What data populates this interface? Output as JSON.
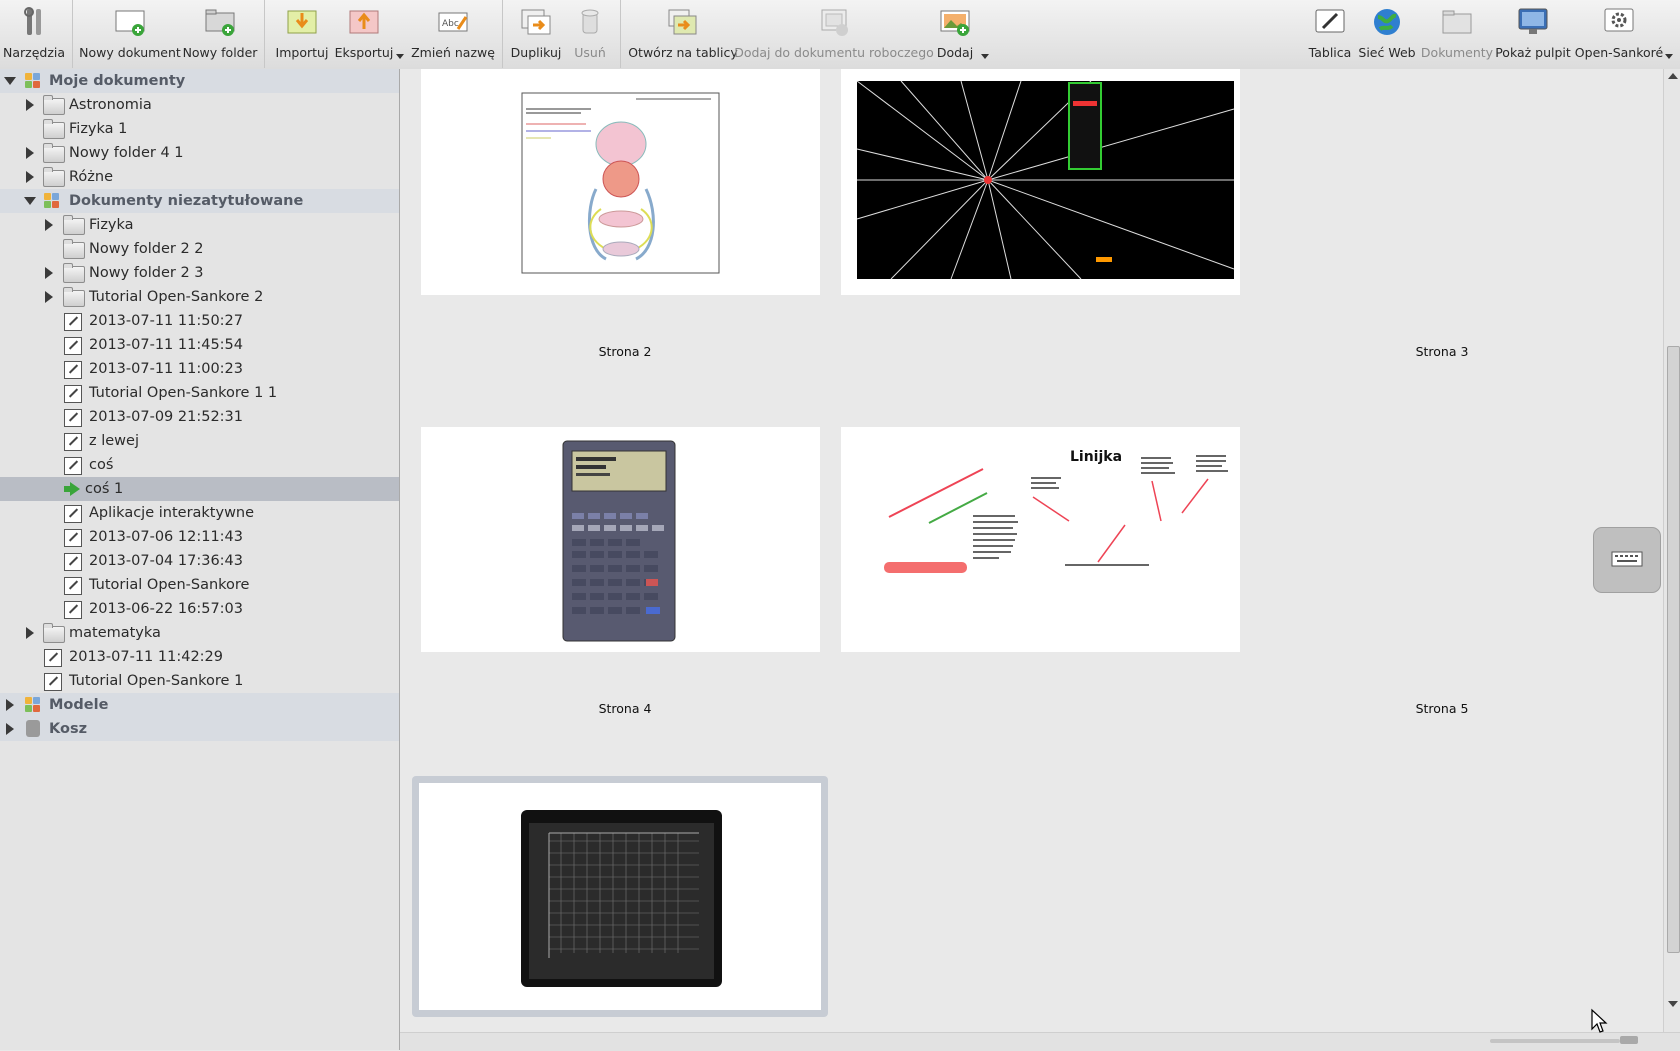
{
  "toolbar": {
    "tools": "Narzędzia",
    "new_document": "Nowy dokument",
    "new_folder": "Nowy folder",
    "import": "Importuj",
    "export": "Eksportuj",
    "rename": "Zmień nazwę",
    "duplicate": "Duplikuj",
    "delete": "Usuń",
    "open_on_board": "Otwórz na tablicy",
    "add_to_working": "Dodaj do dokumentu roboczego",
    "add": "Dodaj",
    "board": "Tablica",
    "web": "Sieć Web",
    "documents": "Dokumenty",
    "show_desktop": "Pokaż pulpit",
    "open_sankore": "Open-Sankoré"
  },
  "sidebar": {
    "items": [
      {
        "label": "Moje dokumenty"
      },
      {
        "label": "Astronomia"
      },
      {
        "label": "Fizyka 1"
      },
      {
        "label": "Nowy folder 4 1"
      },
      {
        "label": "Różne"
      },
      {
        "label": "Dokumenty niezatytułowane"
      },
      {
        "label": "Fizyka"
      },
      {
        "label": "Nowy folder 2 2"
      },
      {
        "label": "Nowy folder 2 3"
      },
      {
        "label": "Tutorial Open-Sankore 2"
      },
      {
        "label": "2013-07-11 11:50:27"
      },
      {
        "label": "2013-07-11 11:45:54"
      },
      {
        "label": "2013-07-11 11:00:23"
      },
      {
        "label": "Tutorial Open-Sankore 1 1"
      },
      {
        "label": "2013-07-09 21:52:31"
      },
      {
        "label": "z lewej"
      },
      {
        "label": "coś"
      },
      {
        "label": "coś 1"
      },
      {
        "label": "Aplikacje interaktywne"
      },
      {
        "label": "2013-07-06 12:11:43"
      },
      {
        "label": "2013-07-04 17:36:43"
      },
      {
        "label": "Tutorial Open-Sankore"
      },
      {
        "label": "2013-06-22 16:57:03"
      },
      {
        "label": "matematyka"
      },
      {
        "label": "2013-07-11 11:42:29"
      },
      {
        "label": "Tutorial Open-Sankore 1"
      },
      {
        "label": "Modele"
      },
      {
        "label": "Kosz"
      }
    ]
  },
  "pages": [
    {
      "label": "Strona 2"
    },
    {
      "label": "Strona 3"
    },
    {
      "label": "Strona 4"
    },
    {
      "label": "Strona 5"
    }
  ],
  "thumb_text": {
    "linijka": "Linijka"
  }
}
